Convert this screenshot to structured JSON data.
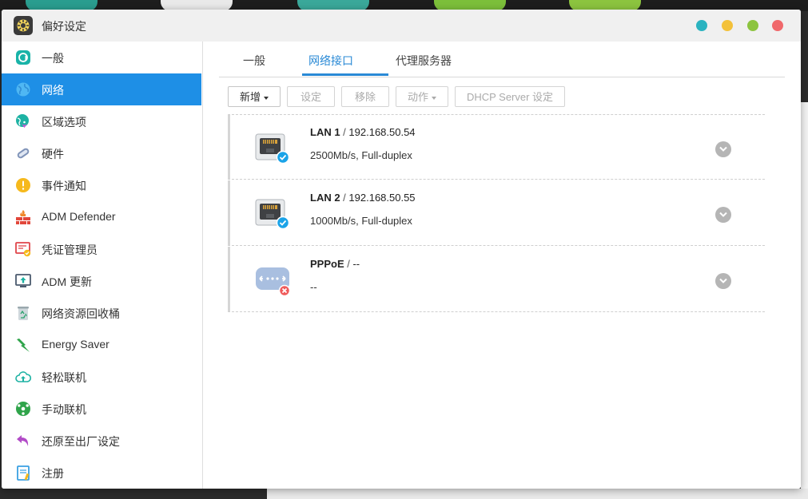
{
  "window": {
    "title": "偏好设定"
  },
  "colors": {
    "accent": "#1e8fe6",
    "tab_accent": "#2a8ad6",
    "win_btn_teal": "#2bb3c0",
    "win_btn_yellow": "#f3c13a",
    "win_btn_green": "#8cc43f",
    "win_btn_red": "#f0686b",
    "status_ok": "#1aa3e8",
    "status_error": "#ef5b5b"
  },
  "sidebar": {
    "items": [
      {
        "label": "一般",
        "icon": "general-icon"
      },
      {
        "label": "网络",
        "icon": "globe-icon",
        "active": true
      },
      {
        "label": "区域选项",
        "icon": "region-icon"
      },
      {
        "label": "硬件",
        "icon": "hardware-icon"
      },
      {
        "label": "事件通知",
        "icon": "alert-icon"
      },
      {
        "label": "ADM Defender",
        "icon": "firewall-icon"
      },
      {
        "label": "凭证管理员",
        "icon": "certificate-icon"
      },
      {
        "label": "ADM 更新",
        "icon": "update-icon"
      },
      {
        "label": "网络资源回收桶",
        "icon": "recycle-bin-icon"
      },
      {
        "label": "Energy Saver",
        "icon": "energy-icon"
      },
      {
        "label": "轻松联机",
        "icon": "cloud-connect-icon"
      },
      {
        "label": "手动联机",
        "icon": "manual-connect-icon"
      },
      {
        "label": "还原至出厂设定",
        "icon": "restore-icon"
      },
      {
        "label": "注册",
        "icon": "register-icon"
      }
    ]
  },
  "tabs": [
    {
      "label": "一般"
    },
    {
      "label": "网络接口",
      "active": true
    },
    {
      "label": "代理服务器"
    }
  ],
  "toolbar": {
    "add": "新增",
    "settings": "设定",
    "remove": "移除",
    "action": "动作",
    "dhcp": "DHCP Server 设定"
  },
  "interfaces": [
    {
      "name": "LAN 1",
      "sep": " / ",
      "ip": "192.168.50.54",
      "detail": "2500Mb/s, Full-duplex",
      "status": "connected",
      "icon": "ethernet-port-icon"
    },
    {
      "name": "LAN 2",
      "sep": " / ",
      "ip": "192.168.50.55",
      "detail": "1000Mb/s, Full-duplex",
      "status": "connected",
      "icon": "ethernet-port-icon"
    },
    {
      "name": "PPPoE",
      "sep": " / ",
      "ip": "--",
      "detail": "--",
      "status": "disconnected",
      "icon": "pppoe-icon"
    }
  ]
}
